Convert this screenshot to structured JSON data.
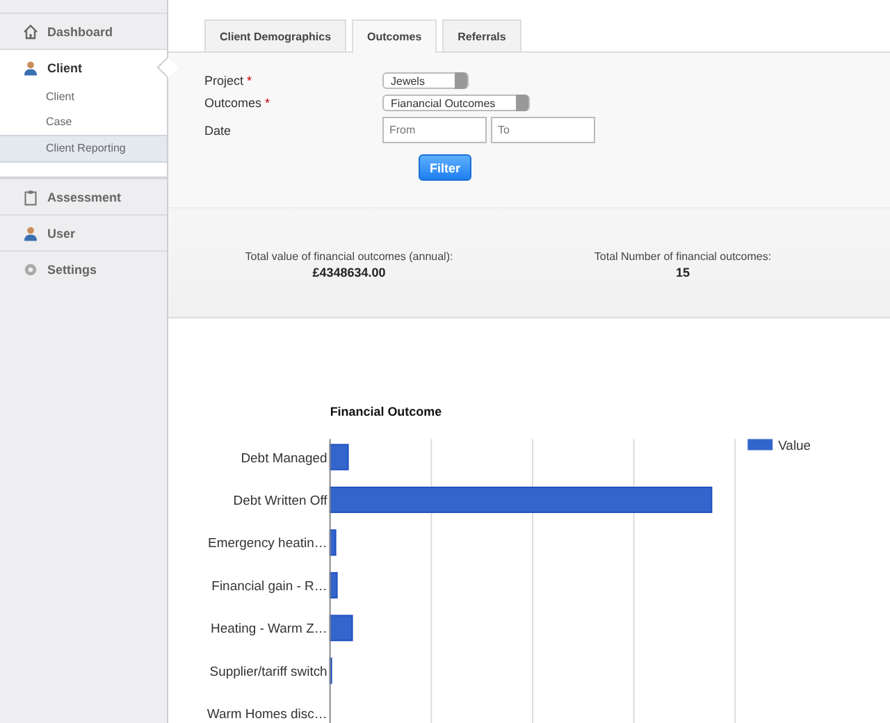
{
  "sidebar": {
    "items": [
      {
        "label": "Dashboard",
        "selected": false
      },
      {
        "label": "Client",
        "selected": true,
        "children": [
          {
            "label": "Client",
            "selected": false
          },
          {
            "label": "Case",
            "selected": false
          },
          {
            "label": "Client Reporting",
            "selected": true
          }
        ]
      },
      {
        "label": "Assessment",
        "selected": false
      },
      {
        "label": "User",
        "selected": false
      },
      {
        "label": "Settings",
        "selected": false
      }
    ]
  },
  "tabs": [
    {
      "label": "Client Demographics",
      "selected": false
    },
    {
      "label": "Outcomes",
      "selected": true
    },
    {
      "label": "Referrals",
      "selected": false
    }
  ],
  "form": {
    "fields": [
      {
        "kind": "select",
        "label": "Project",
        "required": true,
        "value": "Jewels"
      },
      {
        "kind": "select",
        "label": "Outcomes",
        "required": true,
        "value": "Fianancial Outcomes"
      },
      {
        "kind": "range",
        "label": "Date",
        "required": false,
        "from_placeholder": "From",
        "to_placeholder": "To"
      }
    ],
    "required_mark": "*",
    "button": "Filter"
  },
  "summary": [
    {
      "label": "Total value of financial outcomes (annual):",
      "value": "£4348634.00"
    },
    {
      "label": "Total Number of financial outcomes:",
      "value": "15"
    }
  ],
  "chart": {
    "title": "Financial Outcome",
    "legend": "Value",
    "categories": [
      "Debt Managed",
      "Debt Written Off",
      "Emergency heatin…",
      "Financial gain - R…",
      "Heating - Warm Z…",
      "Supplier/tariff switch",
      "Warm Homes disc…"
    ]
  }
}
